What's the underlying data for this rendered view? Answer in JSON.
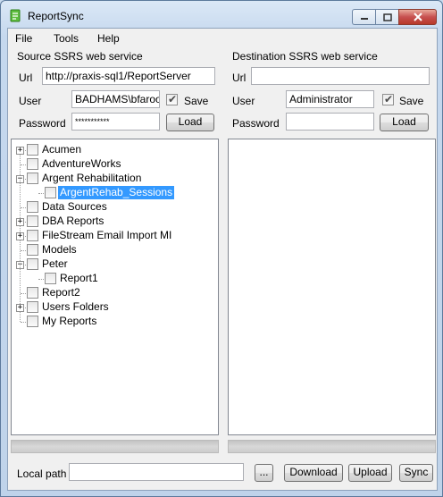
{
  "window": {
    "title": "ReportSync"
  },
  "menu": [
    "File",
    "Tools",
    "Help"
  ],
  "source": {
    "group_label": "Source SSRS web service",
    "url_label": "Url",
    "url_value": "http://praxis-sql1/ReportServer",
    "user_label": "User",
    "user_value": "BADHAMS\\bfarooq",
    "save_label": "Save",
    "save_checked": true,
    "password_label": "Password",
    "password_value": "***********",
    "load_label": "Load"
  },
  "destination": {
    "group_label": "Destination SSRS web service",
    "url_label": "Url",
    "url_value": "",
    "user_label": "User",
    "user_value": "Administrator",
    "save_label": "Save",
    "save_checked": true,
    "password_label": "Password",
    "password_value": "",
    "load_label": "Load"
  },
  "tree": [
    {
      "label": "Acumen",
      "level": 0,
      "expander": "+"
    },
    {
      "label": "AdventureWorks",
      "level": 0,
      "expander": ""
    },
    {
      "label": "Argent Rehabilitation",
      "level": 0,
      "expander": "-"
    },
    {
      "label": "ArgentRehab_Sessions",
      "level": 1,
      "expander": "",
      "selected": true
    },
    {
      "label": "Data Sources",
      "level": 0,
      "expander": ""
    },
    {
      "label": "DBA Reports",
      "level": 0,
      "expander": "+"
    },
    {
      "label": "FileStream Email Import MI",
      "level": 0,
      "expander": "+"
    },
    {
      "label": "Models",
      "level": 0,
      "expander": ""
    },
    {
      "label": "Peter",
      "level": 0,
      "expander": "-"
    },
    {
      "label": "Report1",
      "level": 1,
      "expander": ""
    },
    {
      "label": "Report2",
      "level": 0,
      "expander": ""
    },
    {
      "label": "Users Folders",
      "level": 0,
      "expander": "+"
    },
    {
      "label": "My Reports",
      "level": 0,
      "expander": ""
    }
  ],
  "bottom": {
    "local_path_label": "Local path",
    "local_path_value": "",
    "browse_label": "...",
    "download_label": "Download",
    "upload_label": "Upload",
    "sync_label": "Sync"
  }
}
